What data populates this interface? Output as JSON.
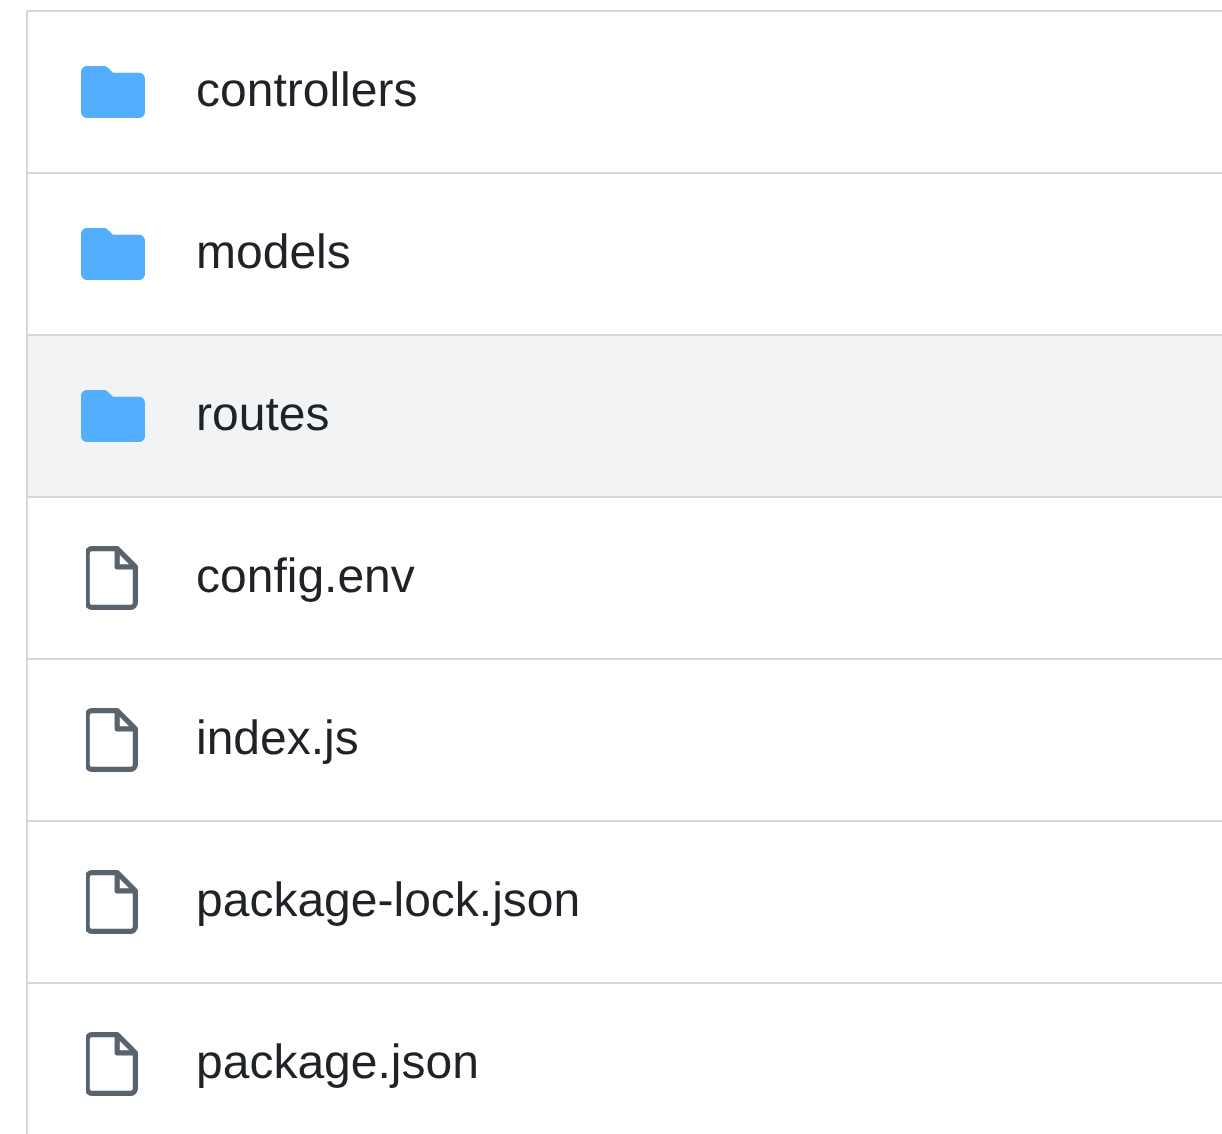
{
  "files": [
    {
      "kind": "folder",
      "name": "controllers",
      "hovered": false
    },
    {
      "kind": "folder",
      "name": "models",
      "hovered": false
    },
    {
      "kind": "folder",
      "name": "routes",
      "hovered": true
    },
    {
      "kind": "file",
      "name": "config.env",
      "hovered": false
    },
    {
      "kind": "file",
      "name": "index.js",
      "hovered": false
    },
    {
      "kind": "file",
      "name": "package-lock.json",
      "hovered": false
    },
    {
      "kind": "file",
      "name": "package.json",
      "hovered": false
    }
  ]
}
